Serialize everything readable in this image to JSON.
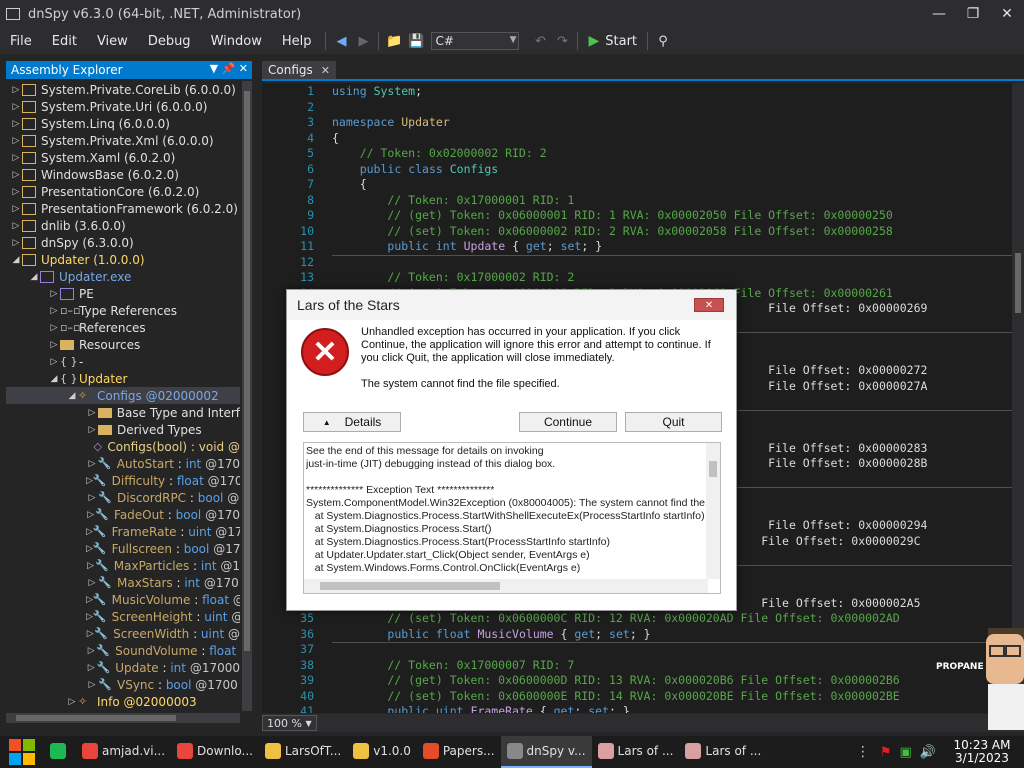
{
  "window": {
    "title": "dnSpy v6.3.0 (64-bit, .NET, Administrator)",
    "minimize": "—",
    "maximize": "❐",
    "close": "✕"
  },
  "menu": [
    "File",
    "Edit",
    "View",
    "Debug",
    "Window",
    "Help"
  ],
  "toolbar": {
    "language": "C#",
    "start_label": "Start"
  },
  "explorer": {
    "title": "Assembly Explorer",
    "rows": [
      {
        "name": "System.Private.CoreLib (6.0.0.0)"
      },
      {
        "name": "System.Private.Uri (6.0.0.0)"
      },
      {
        "name": "System.Linq (6.0.0.0)"
      },
      {
        "name": "System.Private.Xml (6.0.0.0)"
      },
      {
        "name": "System.Xaml (6.0.2.0)"
      },
      {
        "name": "WindowsBase (6.0.2.0)"
      },
      {
        "name": "PresentationCore (6.0.2.0)"
      },
      {
        "name": "PresentationFramework (6.0.2.0)"
      },
      {
        "name": "dnlib (3.6.0.0)"
      },
      {
        "name": "dnSpy (6.3.0.0)"
      },
      {
        "name": "Updater (1.0.0.0)"
      },
      {
        "name": "Updater.exe"
      },
      {
        "name": "PE"
      },
      {
        "name": "Type References"
      },
      {
        "name": "References"
      },
      {
        "name": "Resources"
      },
      {
        "name": "-"
      },
      {
        "name": "Updater"
      },
      {
        "name": "Configs @02000002"
      },
      {
        "name": "Base Type and Interf"
      },
      {
        "name": "Derived Types"
      },
      {
        "name": "Configs(bool) : void @"
      },
      {
        "name": "AutoStart",
        "type": "int",
        "rest": "@170"
      },
      {
        "name": "Difficulty",
        "type": "float",
        "rest": "@170"
      },
      {
        "name": "DiscordRPC",
        "type": "bool",
        "rest": "@"
      },
      {
        "name": "FadeOut",
        "type": "bool",
        "rest": "@170"
      },
      {
        "name": "FrameRate",
        "type": "uint",
        "rest": "@17"
      },
      {
        "name": "Fullscreen",
        "type": "bool",
        "rest": "@17"
      },
      {
        "name": "MaxParticles",
        "type": "int",
        "rest": "@1"
      },
      {
        "name": "MaxStars",
        "type": "int",
        "rest": "@170"
      },
      {
        "name": "MusicVolume",
        "type": "float",
        "rest": "@"
      },
      {
        "name": "ScreenHeight",
        "type": "uint",
        "rest": "@"
      },
      {
        "name": "ScreenWidth",
        "type": "uint",
        "rest": "@"
      },
      {
        "name": "SoundVolume",
        "type": "float",
        "rest": ""
      },
      {
        "name": "Update",
        "type": "int",
        "rest": "@17000"
      },
      {
        "name": "VSync",
        "type": "bool",
        "rest": "@1700"
      },
      {
        "name": "Info @02000003"
      }
    ]
  },
  "editor": {
    "tab": "Configs",
    "tab_close": "✕",
    "zoom": "100 %",
    "lines": [
      {
        "n": "1",
        "t": "using System;"
      },
      {
        "n": "2",
        "t": ""
      },
      {
        "n": "3",
        "t": "namespace Updater"
      },
      {
        "n": "4",
        "t": "{"
      },
      {
        "n": "5",
        "t": "    // Token: 0x02000002 RID: 2"
      },
      {
        "n": "6",
        "t": "    public class Configs"
      },
      {
        "n": "7",
        "t": "    {"
      },
      {
        "n": "8",
        "t": "        // Token: 0x17000001 RID: 1"
      },
      {
        "n": "9",
        "t": "        // (get) Token: 0x06000001 RID: 1 RVA: 0x00002050 File Offset: 0x00000250"
      },
      {
        "n": "10",
        "t": "        // (set) Token: 0x06000002 RID: 2 RVA: 0x00002058 File Offset: 0x00000258"
      },
      {
        "n": "11",
        "t": "        public int Update { get; set; }"
      },
      {
        "n": "12",
        "t": ""
      },
      {
        "n": "13",
        "t": "        // Token: 0x17000002 RID: 2"
      },
      {
        "n": "14",
        "t": "        // (get) Token: 0x06000003 RID: 3 RVA: 0x00002061 File Offset: 0x00000261"
      },
      {
        "n": "15",
        "t": "                                                               File Offset: 0x00000269"
      },
      {
        "n": "16",
        "t": ""
      },
      {
        "n": "17",
        "t": ""
      },
      {
        "n": "18",
        "t": ""
      },
      {
        "n": "19",
        "t": "                                                               File Offset: 0x00000272"
      },
      {
        "n": "20",
        "t": "                                                               File Offset: 0x0000027A"
      },
      {
        "n": "21",
        "t": ""
      },
      {
        "n": "22",
        "t": ""
      },
      {
        "n": "23",
        "t": ""
      },
      {
        "n": "24",
        "t": "                                                               File Offset: 0x00000283"
      },
      {
        "n": "25",
        "t": "                                                               File Offset: 0x0000028B"
      },
      {
        "n": "26",
        "t": ""
      },
      {
        "n": "27",
        "t": ""
      },
      {
        "n": "28",
        "t": ""
      },
      {
        "n": "29",
        "t": "                                                               File Offset: 0x00000294"
      },
      {
        "n": "30",
        "t": "                                                              File Offset: 0x0000029C"
      },
      {
        "n": "31",
        "t": ""
      },
      {
        "n": "32",
        "t": ""
      },
      {
        "n": "33",
        "t": ""
      },
      {
        "n": "34",
        "t": "                                                              File Offset: 0x000002A5"
      },
      {
        "n": "35",
        "t": "        // (set) Token: 0x0600000C RID: 12 RVA: 0x000020AD File Offset: 0x000002AD"
      },
      {
        "n": "36",
        "t": "        public float MusicVolume { get; set; }"
      },
      {
        "n": "37",
        "t": ""
      },
      {
        "n": "38",
        "t": "        // Token: 0x17000007 RID: 7"
      },
      {
        "n": "39",
        "t": "        // (get) Token: 0x0600000D RID: 13 RVA: 0x000020B6 File Offset: 0x000002B6"
      },
      {
        "n": "40",
        "t": "        // (set) Token: 0x0600000E RID: 14 RVA: 0x000020BE File Offset: 0x000002BE"
      },
      {
        "n": "41",
        "t": "        public uint FrameRate { get; set; }"
      }
    ]
  },
  "dialog": {
    "title": "Lars of the Stars",
    "close": "✕",
    "message": "Unhandled exception has occurred in your application. If you click Continue, the application will ignore this error and attempt to continue. If you click Quit, the application will close immediately.",
    "message2": "The system cannot find the file specified.",
    "details_button": "Details",
    "continue_button": "Continue",
    "quit_button": "Quit",
    "details_text": "See the end of this message for details on invoking\njust-in-time (JIT) debugging instead of this dialog box.\n\n************** Exception Text **************\nSystem.ComponentModel.Win32Exception (0x80004005): The system cannot find the\n   at System.Diagnostics.Process.StartWithShellExecuteEx(ProcessStartInfo startInfo)\n   at System.Diagnostics.Process.Start()\n   at System.Diagnostics.Process.Start(ProcessStartInfo startInfo)\n   at Updater.Updater.start_Click(Object sender, EventArgs e)\n   at System.Windows.Forms.Control.OnClick(EventArgs e)"
  },
  "overlay": {
    "propane_label": "PROPANE"
  },
  "taskbar": {
    "items": [
      {
        "label": "",
        "color": "#1db954"
      },
      {
        "label": "amjad.vi...",
        "color": "#e8453c"
      },
      {
        "label": "Downlo...",
        "color": "#e8453c"
      },
      {
        "label": "LarsOfT...",
        "color": "#f0c040"
      },
      {
        "label": "v1.0.0",
        "color": "#f0c040"
      },
      {
        "label": "Papers...",
        "color": "#e34c26"
      },
      {
        "label": "dnSpy v...",
        "color": "#888888"
      },
      {
        "label": "Lars of ...",
        "color": "#d9a0a0"
      },
      {
        "label": "Lars of ...",
        "color": "#d9a0a0"
      }
    ],
    "time": "10:23 AM",
    "date": "3/1/2023"
  }
}
